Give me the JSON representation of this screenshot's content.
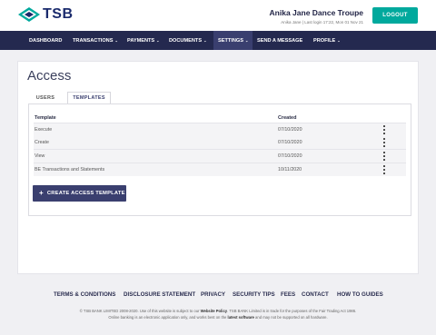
{
  "brand": {
    "name": "TSB",
    "accent": "#00a99d",
    "navy": "#24294f"
  },
  "header": {
    "user_name": "Anika Jane Dance Troupe",
    "user_sub": "Anika Jane  |  Last login 17:22, Mon 01 Nov 21",
    "logout_label": "LOGOUT"
  },
  "nav": {
    "items": [
      {
        "label": "DASHBOARD",
        "dropdown": false
      },
      {
        "label": "TRANSACTIONS",
        "dropdown": true
      },
      {
        "label": "PAYMENTS",
        "dropdown": true
      },
      {
        "label": "DOCUMENTS",
        "dropdown": true
      },
      {
        "label": "SETTINGS",
        "dropdown": true,
        "active": true
      },
      {
        "label": "SEND A MESSAGE",
        "dropdown": false
      },
      {
        "label": "PROFILE",
        "dropdown": true
      }
    ]
  },
  "page": {
    "title": "Access",
    "tabs": [
      {
        "label": "USERS",
        "active": false
      },
      {
        "label": "TEMPLATES",
        "active": true
      }
    ],
    "table": {
      "columns": [
        "Template",
        "Created"
      ],
      "rows": [
        {
          "template": "Execute",
          "created": "07/10/2020"
        },
        {
          "template": "Create",
          "created": "07/10/2020"
        },
        {
          "template": "View",
          "created": "07/10/2020"
        },
        {
          "template": "BE Transactions and Statements",
          "created": "10/11/2020"
        }
      ]
    },
    "create_button": "CREATE ACCESS TEMPLATE"
  },
  "footer": {
    "links": [
      "TERMS & CONDITIONS",
      "DISCLOSURE STATEMENT",
      "PRIVACY",
      "SECURITY TIPS",
      "FEES",
      "CONTACT",
      "HOW TO GUIDES"
    ],
    "copy_line1_a": "© TSB BANK LIMITED 2008-2020. Use of this website is subject to our ",
    "copy_line1_link": "Website Policy",
    "copy_line1_b": ". TSB BANK Limited is in trade for the purposes of the Fair Trading Act 1986.",
    "copy_line2_a": "Online banking is an electronic application only, and works best on the ",
    "copy_line2_link": "latest software",
    "copy_line2_b": " and may not be supported on all hardware."
  }
}
